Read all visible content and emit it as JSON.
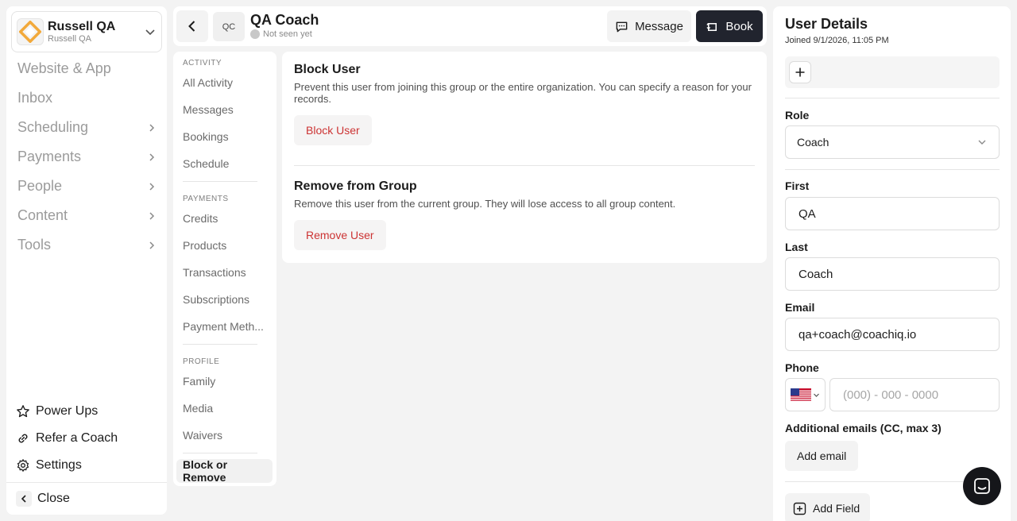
{
  "org": {
    "name": "Russell QA",
    "subtitle": "Russell QA",
    "logo_icon": "diamond-logo-icon"
  },
  "nav": {
    "items": [
      {
        "label": "Website & App",
        "has_chevron": false
      },
      {
        "label": "Inbox",
        "has_chevron": false
      },
      {
        "label": "Scheduling",
        "has_chevron": true
      },
      {
        "label": "Payments",
        "has_chevron": true
      },
      {
        "label": "People",
        "has_chevron": true
      },
      {
        "label": "Content",
        "has_chevron": true
      },
      {
        "label": "Tools",
        "has_chevron": true
      }
    ],
    "bottom_links": [
      {
        "label": "Power Ups",
        "icon": "star-icon"
      },
      {
        "label": "Refer a Coach",
        "icon": "link-icon"
      },
      {
        "label": "Settings",
        "icon": "gear-icon"
      }
    ],
    "close_label": "Close"
  },
  "header": {
    "avatar_initials": "QC",
    "user_name": "QA Coach",
    "status": "Not seen yet",
    "message_label": "Message",
    "book_label": "Book"
  },
  "subnav": {
    "sections": [
      {
        "title": "ACTIVITY",
        "items": [
          "All Activity",
          "Messages",
          "Bookings",
          "Schedule"
        ]
      },
      {
        "title": "PAYMENTS",
        "items": [
          "Credits",
          "Products",
          "Transactions",
          "Subscriptions",
          "Payment Meth..."
        ]
      },
      {
        "title": "PROFILE",
        "items": [
          "Family",
          "Media",
          "Waivers"
        ]
      }
    ],
    "active_item": "Block or Remove"
  },
  "main": {
    "block": {
      "title": "Block User",
      "description": "Prevent this user from joining this group or the entire organization. You can specify a reason for your records.",
      "button_label": "Block User"
    },
    "remove": {
      "title": "Remove from Group",
      "description": "Remove this user from the current group. They will lose access to all group content.",
      "button_label": "Remove User"
    }
  },
  "user_details": {
    "title": "User Details",
    "joined": "Joined 9/1/2026, 11:05 PM",
    "role_label": "Role",
    "role_value": "Coach",
    "first_label": "First",
    "first_value": "QA",
    "last_label": "Last",
    "last_value": "Coach",
    "email_label": "Email",
    "email_value": "qa+coach@coachiq.io",
    "phone_label": "Phone",
    "phone_placeholder": "(000) - 000 - 0000",
    "phone_country_icon": "us-flag-icon",
    "additional_emails_label": "Additional emails (CC, max 3)",
    "add_email_label": "Add email",
    "add_field_label": "Add Field"
  },
  "colors": {
    "accent_dark": "#21242e",
    "danger": "#cc3333",
    "logo_orange": "#f2a93b"
  }
}
